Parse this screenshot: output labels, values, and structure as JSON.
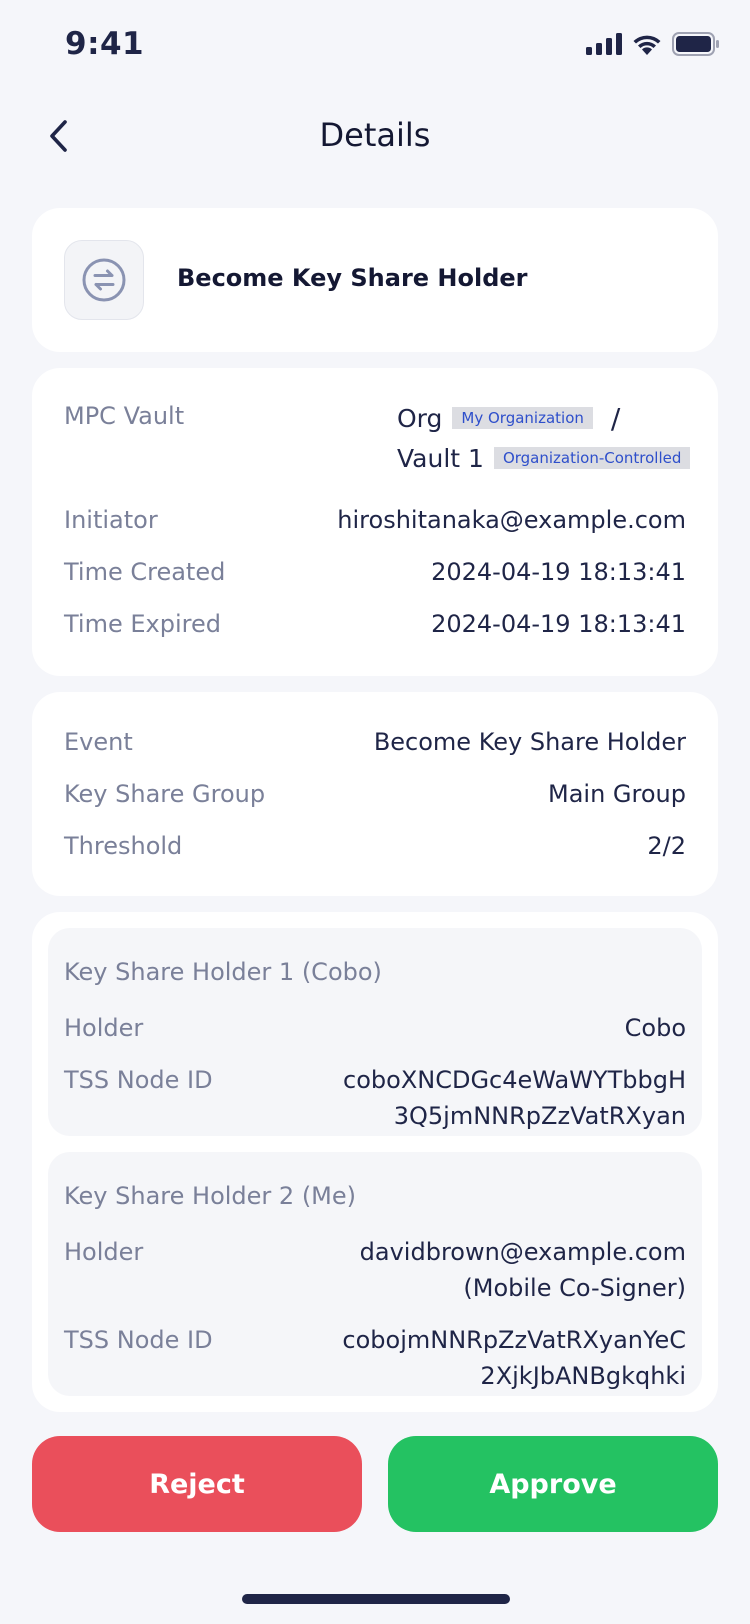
{
  "status_bar": {
    "time": "9:41"
  },
  "nav": {
    "title": "Details"
  },
  "event_card": {
    "title": "Become Key Share Holder",
    "icon": "swap-arrows-icon"
  },
  "vault": {
    "label": "MPC Vault",
    "org_name": "Org",
    "org_tag": "My Organization",
    "separator": "/",
    "vault_name": "Vault 1",
    "vault_tag": "Organization-Controlled",
    "initiator_label": "Initiator",
    "initiator": "hiroshitanaka@example.com",
    "created_label": "Time Created",
    "created": "2024-04-19 18:13:41",
    "expired_label": "Time Expired",
    "expired": "2024-04-19 18:13:41"
  },
  "info": {
    "event_label": "Event",
    "event": "Become Key Share Holder",
    "group_label": "Key Share Group",
    "group": "Main Group",
    "threshold_label": "Threshold",
    "threshold": "2/2"
  },
  "holders": [
    {
      "title": "Key Share Holder 1 (Cobo)",
      "holder_label": "Holder",
      "holder_line1": "Cobo",
      "tss_label": "TSS Node ID",
      "tss_line1": "coboXNCDGc4eWaWYTbbgH",
      "tss_line2": "3Q5jmNNRpZzVatRXyan"
    },
    {
      "title": "Key Share Holder 2 (Me)",
      "holder_label": "Holder",
      "holder_line1": "davidbrown@example.com",
      "holder_line2": "(Mobile Co-Signer)",
      "tss_label": "TSS Node ID",
      "tss_line1": "cobojmNNRpZzVatRXyanYeC",
      "tss_line2": "2XjkJbANBgkqhki"
    }
  ],
  "actions": {
    "reject": "Reject",
    "approve": "Approve"
  },
  "colors": {
    "reject": "#EA4F5B",
    "approve": "#24C262",
    "tag_text": "#2E4FCB",
    "text": "#1F2547",
    "label": "#7A8099"
  }
}
